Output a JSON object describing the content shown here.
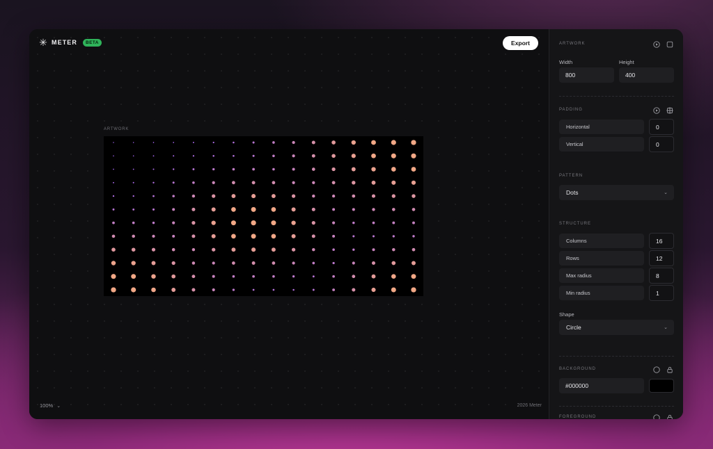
{
  "app": {
    "name": "METER",
    "badge": "BETA",
    "logo_icon": "asterisk-icon"
  },
  "toolbar": {
    "export_label": "Export"
  },
  "canvas": {
    "artwork_label": "ARTWORK",
    "zoom": "100%",
    "footer": "2026 Meter"
  },
  "panel": {
    "artwork": {
      "title": "ARTWORK",
      "width_label": "Width",
      "width_value": "800",
      "height_label": "Height",
      "height_value": "400"
    },
    "padding": {
      "title": "PADDING",
      "horizontal_label": "Horizontal",
      "horizontal_value": "0",
      "vertical_label": "Vertical",
      "vertical_value": "0"
    },
    "pattern": {
      "title": "PATTERN",
      "value": "Dots"
    },
    "structure": {
      "title": "STRUCTURE",
      "columns_label": "Columns",
      "columns_value": "16",
      "rows_label": "Rows",
      "rows_value": "12",
      "max_radius_label": "Max radius",
      "max_radius_value": "8",
      "min_radius_label": "Min radius",
      "min_radius_value": "1",
      "shape_label": "Shape",
      "shape_value": "Circle"
    },
    "background": {
      "title": "BACKGROUND",
      "value": "#000000",
      "swatch_color": "#000000"
    },
    "foreground": {
      "title": "FOREGROUND"
    }
  },
  "colors": {
    "dot_cool": "#9d5ff0",
    "dot_warm": "#f2a886",
    "export_bg": "#ffffff",
    "badge_bg": "#2fb35a"
  }
}
